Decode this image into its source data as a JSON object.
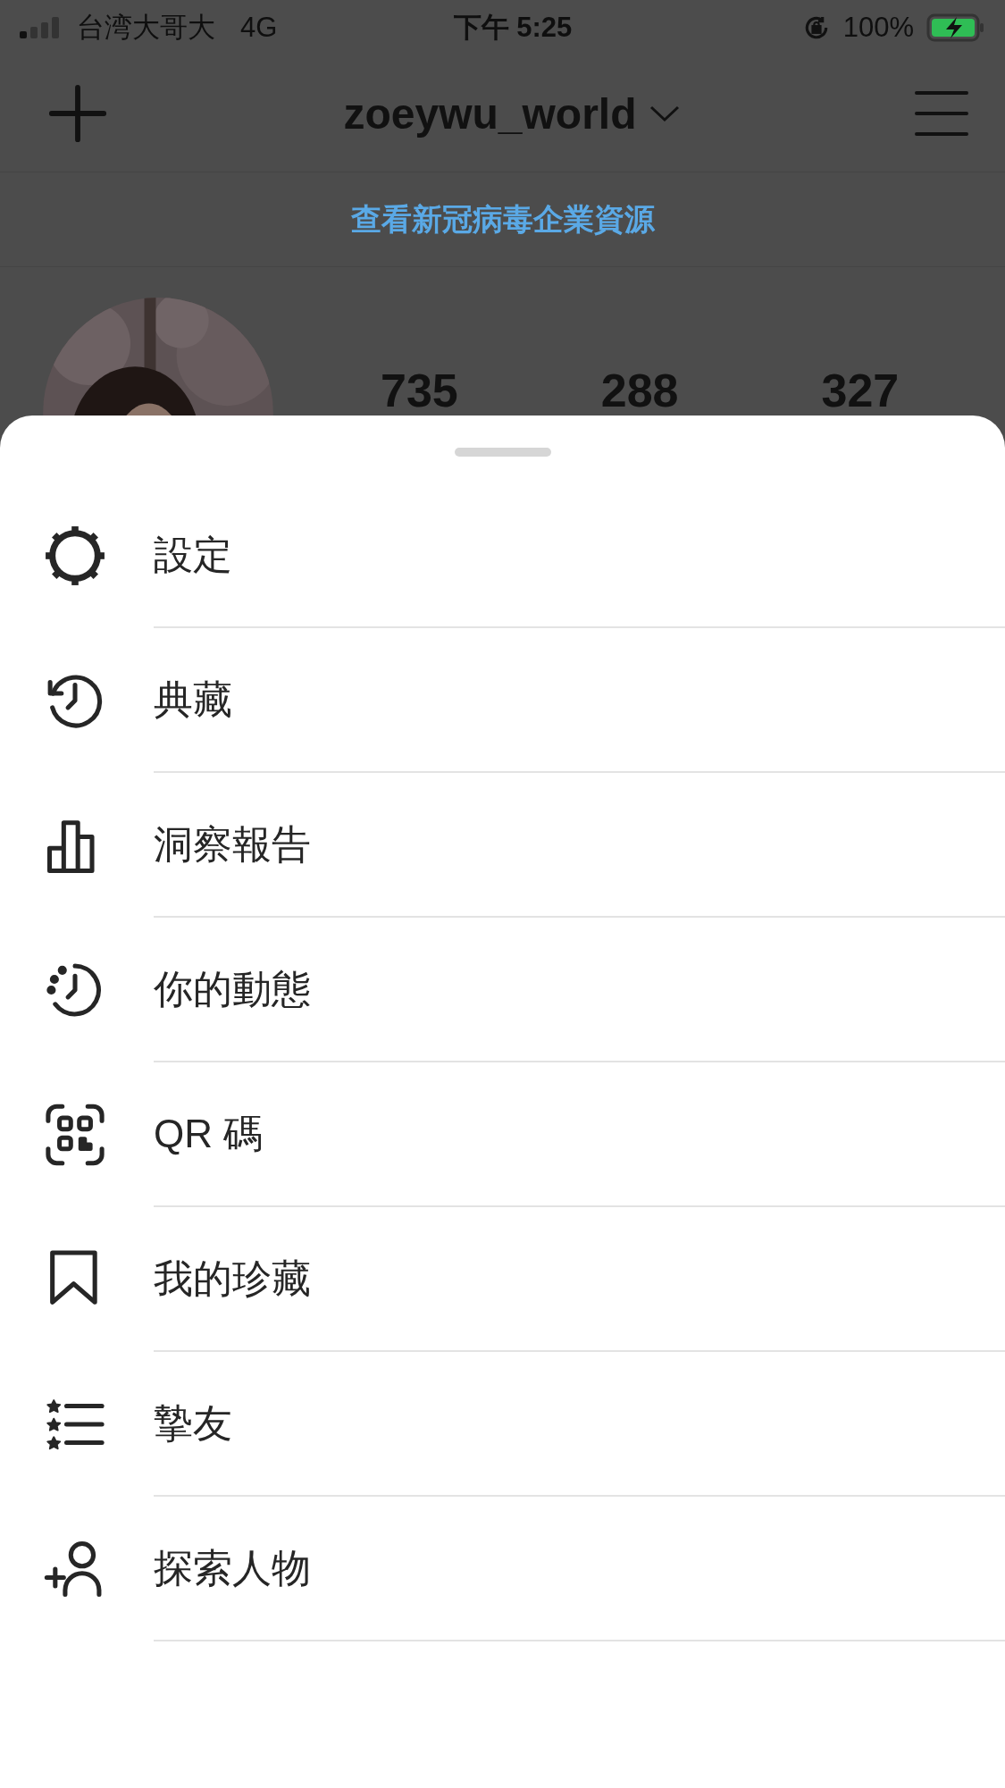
{
  "status_bar": {
    "carrier": "台湾大哥大",
    "network": "4G",
    "time": "下午 5:25",
    "battery": "100%"
  },
  "header": {
    "title": "zoeywu_world"
  },
  "banner": {
    "link": "查看新冠病毒企業資源"
  },
  "profile": {
    "counts": [
      "735",
      "288",
      "327"
    ]
  },
  "menu": [
    {
      "kind": "gear",
      "label": "設定"
    },
    {
      "kind": "history",
      "label": "典藏"
    },
    {
      "kind": "chart",
      "label": "洞察報告"
    },
    {
      "kind": "activity",
      "label": "你的動態"
    },
    {
      "kind": "qr",
      "label": "QR 碼"
    },
    {
      "kind": "bookmark",
      "label": "我的珍藏"
    },
    {
      "kind": "stars",
      "label": "摯友"
    },
    {
      "kind": "add-person",
      "label": "探索人物"
    }
  ]
}
